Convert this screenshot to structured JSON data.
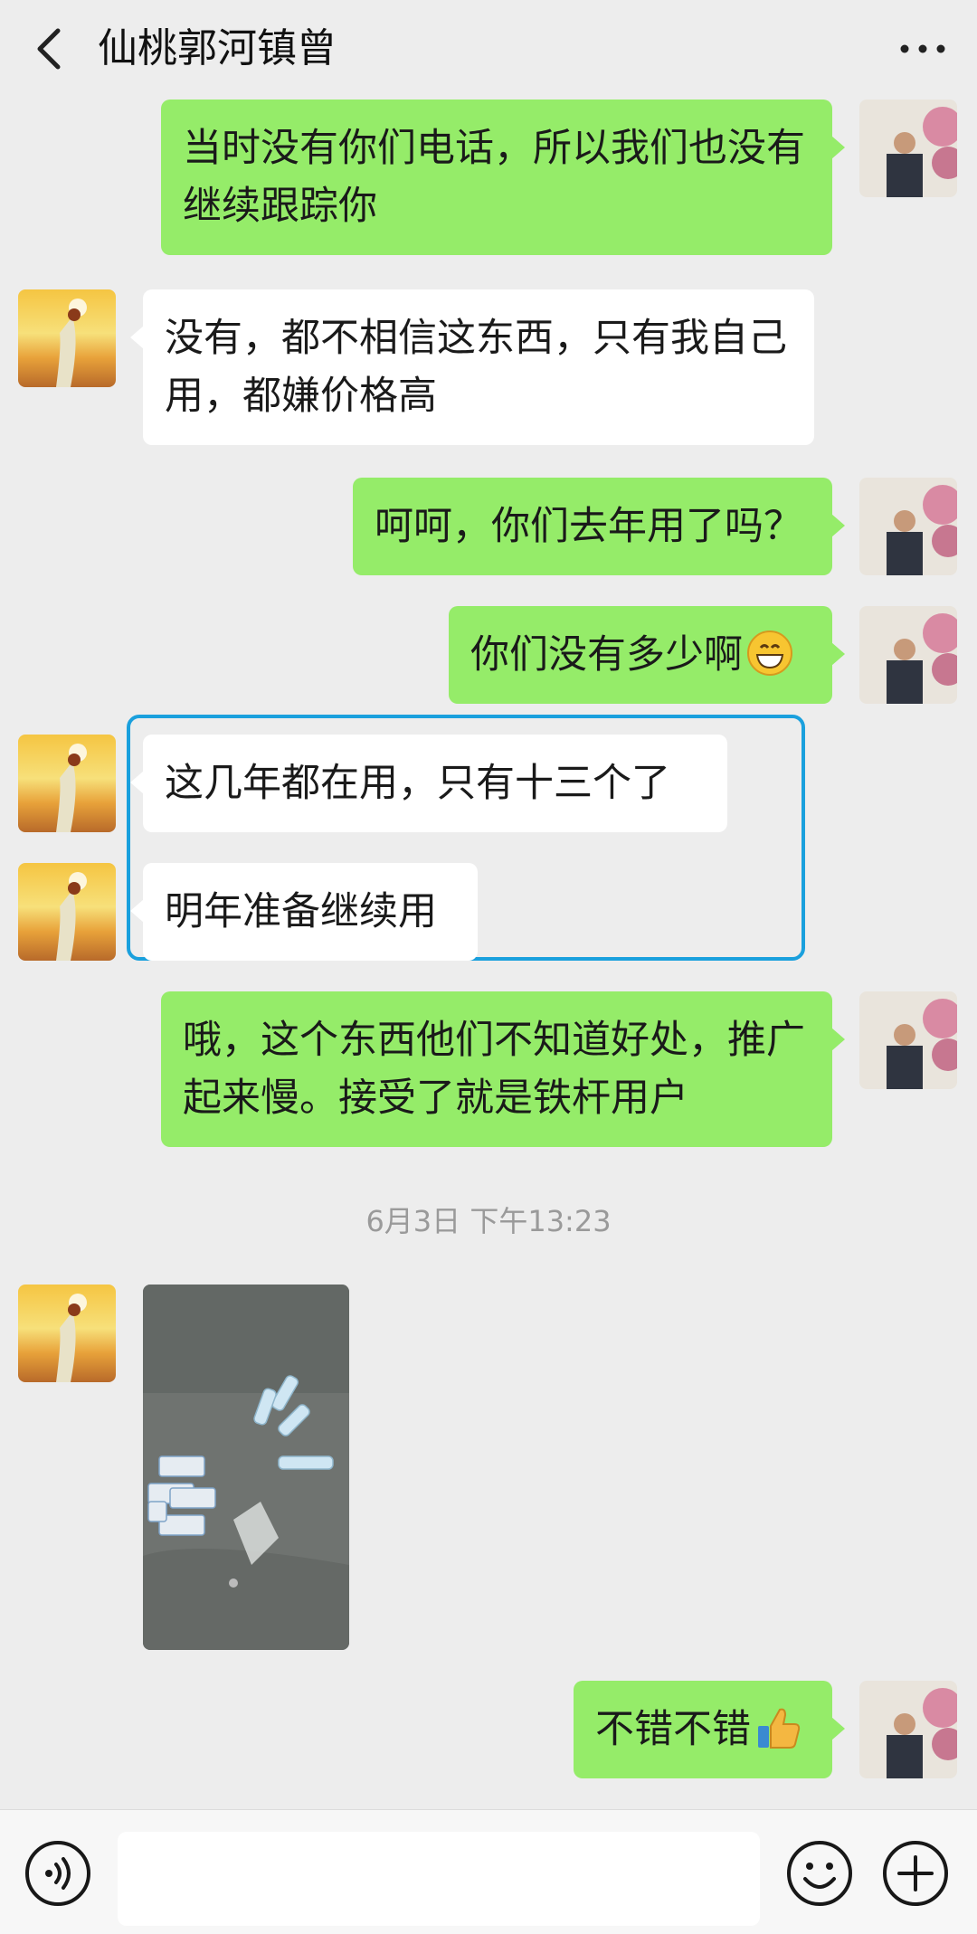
{
  "header": {
    "title": "仙桃郭河镇曾",
    "back_icon": "chevron-left-icon",
    "more_icon": "more-dots-icon"
  },
  "messages": [
    {
      "sender": "me",
      "text": "当时没有你们电话，所以我们也没有继续跟踪你"
    },
    {
      "sender": "other",
      "text": "没有，都不相信这东西，只有我自己用，都嫌价格高"
    },
    {
      "sender": "me",
      "text": "呵呵，你们去年用了吗？"
    },
    {
      "sender": "me",
      "text": "你们没有多少啊",
      "emoji": "grinning-face-emoji"
    },
    {
      "sender": "other",
      "text": "这几年都在用，只有十三个了"
    },
    {
      "sender": "other",
      "text": "明年准备继续用"
    },
    {
      "sender": "me",
      "text": "哦，这个东西他们不知道好处，推广起来慢。接受了就是铁杆用户"
    },
    {
      "sender": "other",
      "type": "image"
    },
    {
      "sender": "me",
      "text": "不错不错",
      "emoji": "thumbs-up-emoji"
    }
  ],
  "timestamp": "6月3日 下午13:23",
  "input_bar": {
    "value": "",
    "voice_icon": "voice-icon",
    "emoji_icon": "emoji-icon",
    "plus_icon": "plus-icon"
  },
  "colors": {
    "background": "#ededed",
    "my_bubble": "#95ec69",
    "other_bubble": "#ffffff",
    "highlight": "#1aa0dd"
  }
}
